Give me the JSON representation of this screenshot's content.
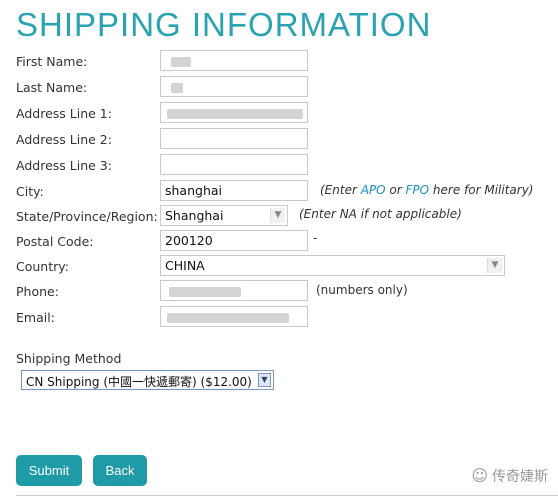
{
  "page": {
    "title": "SHIPPING INFORMATION"
  },
  "form": {
    "first_name_label": "First Name:",
    "last_name_label": "Last Name:",
    "address1_label": "Address Line 1:",
    "address2_label": "Address Line 2:",
    "address3_label": "Address Line 3:",
    "city_label": "City:",
    "city_value": "shanghai",
    "city_note_pre": "(Enter ",
    "city_note_apo": "APO",
    "city_note_or": " or ",
    "city_note_fpo": "FPO",
    "city_note_post": " here for Military)",
    "state_label": "State/Province/Region:",
    "state_value": "Shanghai",
    "state_note": "(Enter NA if not applicable)",
    "postal_label": "Postal Code:",
    "postal_value": "200120",
    "postal_suffix": "-",
    "country_label": "Country:",
    "country_value": "CHINA",
    "phone_label": "Phone:",
    "phone_note": "(numbers only)",
    "email_label": "Email:"
  },
  "shipping": {
    "label": "Shipping Method",
    "selected": "CN Shipping (中國一快遞郵寄) ($12.00)"
  },
  "buttons": {
    "submit": "Submit",
    "back": "Back"
  },
  "brand": {
    "text": "传奇婕斯",
    "icon": "wechat-icon"
  },
  "colors": {
    "accent": "#2aa3b0",
    "button": "#1e9ba6",
    "link": "#1a8fc4"
  }
}
